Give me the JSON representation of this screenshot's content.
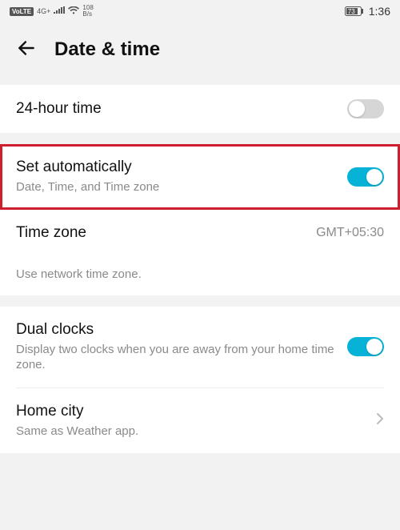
{
  "status": {
    "volte": "VoLTE",
    "net_type": "4G+",
    "speed_value": "108",
    "speed_unit": "B/s",
    "battery": "73",
    "time": "1:36"
  },
  "header": {
    "title": "Date & time"
  },
  "rows": {
    "hour24": {
      "title": "24-hour time",
      "enabled": false
    },
    "set_auto": {
      "title": "Set automatically",
      "subtitle": "Date, Time, and Time zone",
      "enabled": true
    },
    "timezone": {
      "title": "Time zone",
      "value": "GMT+05:30"
    },
    "note": "Use network time zone.",
    "dual_clocks": {
      "title": "Dual clocks",
      "subtitle": "Display two clocks when you are away from your home time zone.",
      "enabled": true
    },
    "home_city": {
      "title": "Home city",
      "subtitle": "Same as Weather app."
    }
  }
}
